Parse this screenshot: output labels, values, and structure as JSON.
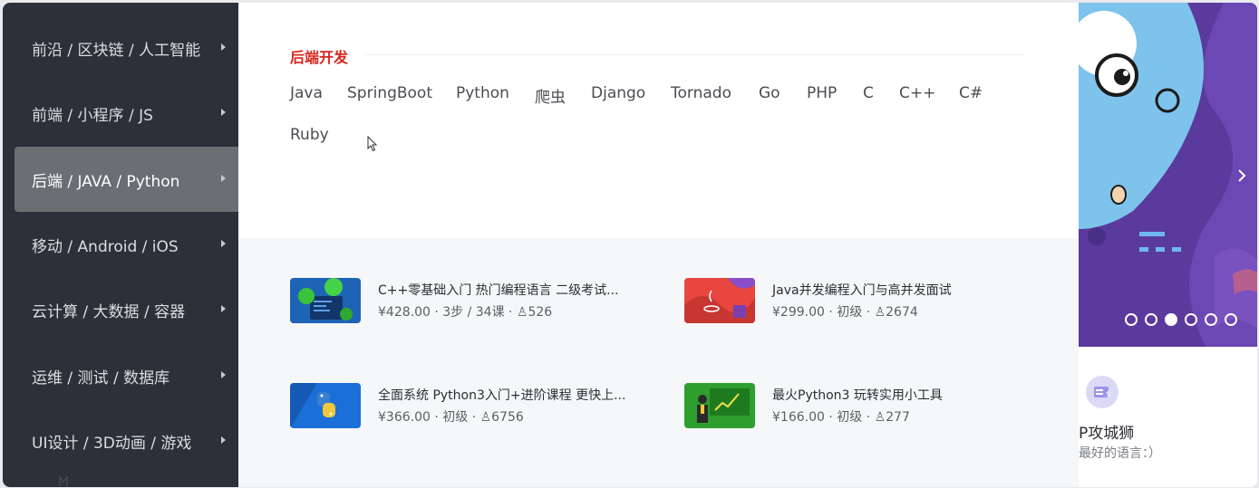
{
  "sidebar": {
    "items": [
      {
        "label": "前沿 / 区块链 / 人工智能"
      },
      {
        "label": "前端 / 小程序 / JS"
      },
      {
        "label": "后端 / JAVA / Python"
      },
      {
        "label": "移动 / Android / iOS"
      },
      {
        "label": "云计算 / 大数据 / 容器"
      },
      {
        "label": "运维 / 测试 / 数据库"
      },
      {
        "label": "UI设计 / 3D动画 / 游戏"
      }
    ],
    "active_index": 2
  },
  "section": {
    "title": "后端开发",
    "tags": [
      "Java",
      "SpringBoot",
      "Python",
      "爬虫",
      "Django",
      "Tornado",
      "Go",
      "PHP",
      "C",
      "C++",
      "C#",
      "Ruby"
    ]
  },
  "courses": [
    {
      "title": "C++零基础入门 热门编程语言 二级考试...",
      "meta": "¥428.00 · 3步 / 34课 · ♙526"
    },
    {
      "title": "Java并发编程入门与高并发面试",
      "meta": "¥299.00 · 初级 · ♙2674"
    },
    {
      "title": "全面系统 Python3入门+进阶课程 更快上...",
      "meta": "¥366.00 · 初级 · ♙6756"
    },
    {
      "title": "最火Python3 玩转实用小工具",
      "meta": "¥166.00 · 初级 · ♙277"
    }
  ],
  "banner": {
    "dot_count": 6,
    "active_dot": 2
  },
  "right_card": {
    "name": "P攻城狮",
    "subtitle": "最好的语言：）"
  },
  "colors": {
    "sidebar_bg": "#2b3039",
    "sidebar_active": "#6b6e73",
    "accent_red": "#d6271e",
    "banner_purple": "#5a3a9c"
  }
}
